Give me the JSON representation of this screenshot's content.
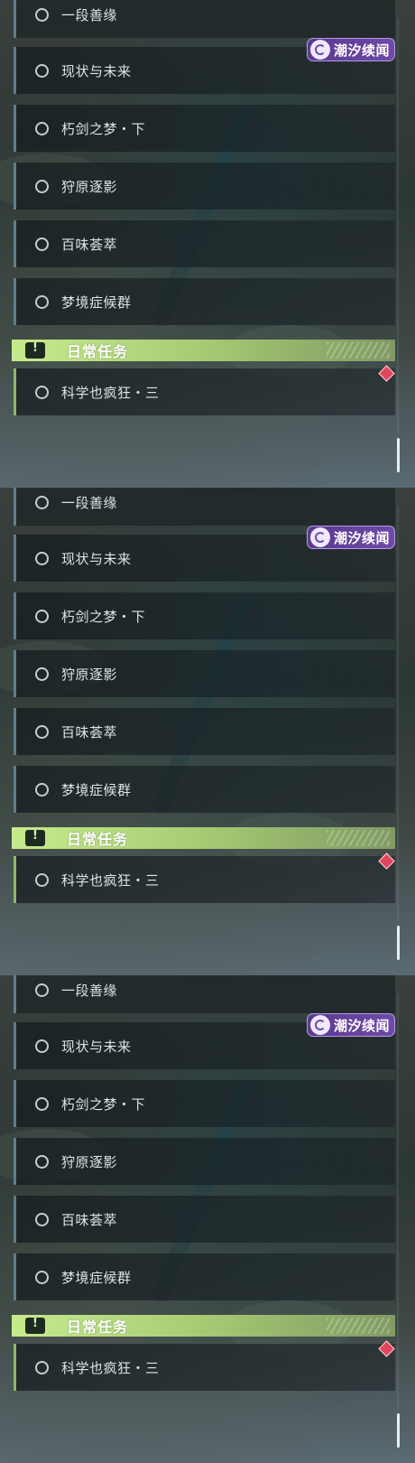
{
  "quest_panel": {
    "badge_label": "潮汐续闻",
    "badge_icon": "tide-news-icon",
    "quests": [
      "一段善缘",
      "现状与未来",
      "朽剑之梦・下",
      "狩原逐影",
      "百味荟萃",
      "梦境症候群"
    ],
    "daily_title": "日常任务",
    "daily_icon": "exclamation-icon",
    "daily_quest": "科学也疯狂・三",
    "alert_color": "#e0475a",
    "daily_accent": "#c7ea8e"
  }
}
